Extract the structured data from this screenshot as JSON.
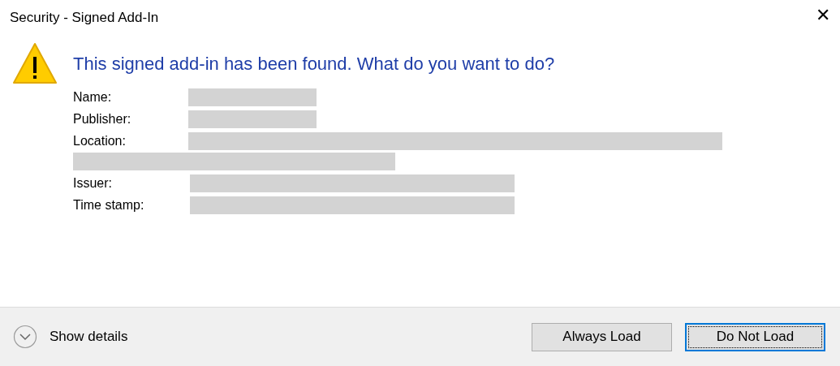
{
  "window": {
    "title": "Security - Signed Add-In",
    "close": "✕"
  },
  "heading": "This signed add-in has been found. What do you want to do?",
  "fields": [
    {
      "label": "Name:",
      "kind": "short"
    },
    {
      "label": "Publisher:",
      "kind": "short"
    },
    {
      "label": "Location:",
      "kind": "wrapped"
    },
    {
      "label": "Issuer:",
      "kind": "medium"
    },
    {
      "label": "Time stamp:",
      "kind": "medium"
    }
  ],
  "details": {
    "label": "Show details",
    "expanded": false
  },
  "buttons": [
    {
      "label": "Always Load",
      "focused": false
    },
    {
      "label": "Do Not Load",
      "focused": true
    }
  ]
}
